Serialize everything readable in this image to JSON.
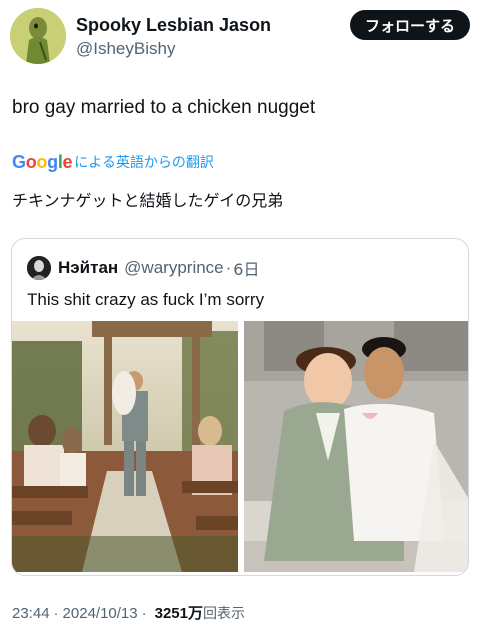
{
  "tweet": {
    "display_name": "Spooky Lesbian Jason",
    "handle": "@IsheyBishy",
    "follow_label": "フォローする",
    "text": "bro gay married to a chicken nugget",
    "translate": {
      "logo_letters": [
        "G",
        "o",
        "o",
        "g",
        "l",
        "e"
      ],
      "label": "による英語からの翻訳"
    },
    "translated_text": "チキンナゲットと結婚したゲイの兄弟",
    "meta": {
      "time": "23:44",
      "separator": "·",
      "date": "2024/10/13",
      "views_count": "3251万",
      "views_label": "回表示"
    }
  },
  "quoted": {
    "display_name": "Нэйтан",
    "handle": "@waryprince",
    "separator": "·",
    "time": "6日",
    "text": "This shit crazy as fuck I’m sorry",
    "photos": [
      "wedding-aisle-photo",
      "couple-portrait-photo"
    ]
  },
  "colors": {
    "text": "#0f1419",
    "secondary": "#536471",
    "link": "#1d9bf0",
    "border": "#cfd9de",
    "follow_bg": "#0f1419"
  }
}
